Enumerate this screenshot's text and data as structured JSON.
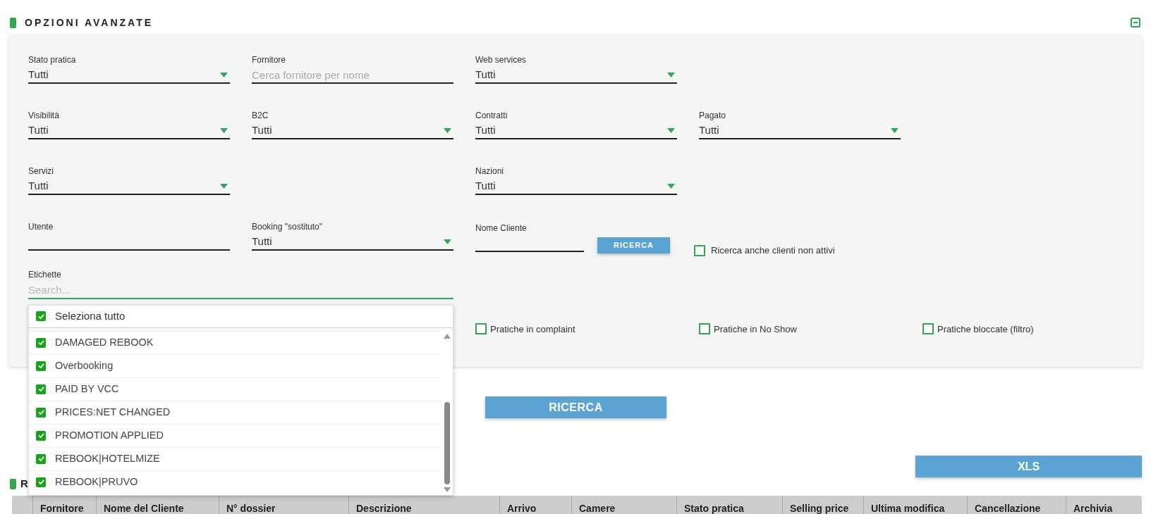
{
  "section_title": "OPZIONI AVANZATE",
  "filter_rows": [
    [
      {
        "kind": "select",
        "label": "Stato pratica",
        "value": "Tutti"
      },
      {
        "kind": "text",
        "label": "Fornitore",
        "placeholder": "Cerca fornitore per nome"
      },
      {
        "kind": "select",
        "label": "Web services",
        "value": "Tutti"
      }
    ],
    [
      {
        "kind": "select",
        "label": "Visibilità",
        "value": "Tutti"
      },
      {
        "kind": "select",
        "label": "B2C",
        "value": "Tutti"
      },
      {
        "kind": "select",
        "label": "Contratti",
        "value": "Tutti"
      },
      {
        "kind": "select",
        "label": "Pagato",
        "value": "Tutti"
      }
    ],
    [
      {
        "kind": "select",
        "label": "Servizi",
        "value": "Tutti"
      },
      {
        "kind": "empty"
      },
      {
        "kind": "select",
        "label": "Nazioni",
        "value": "Tutti"
      }
    ],
    [
      {
        "kind": "text",
        "label": "Utente"
      },
      {
        "kind": "select",
        "label": "Booking \"sostituto\"",
        "value": "Tutti"
      },
      {
        "kind": "client_search",
        "label": "Nome Cliente",
        "button": "RICERCA"
      },
      {
        "kind": "checkbox",
        "label": "Ricerca anche clienti non attivi",
        "checked": false
      }
    ]
  ],
  "tags": {
    "label": "Etichette",
    "placeholder": "Search...",
    "dropdown": {
      "select_all": {
        "label": "Seleziona tutto",
        "checked": true
      },
      "options": [
        {
          "label": "DAMAGED REBOOK",
          "checked": true
        },
        {
          "label": "Overbooking",
          "checked": true
        },
        {
          "label": "PAID BY VCC",
          "checked": true
        },
        {
          "label": "PRICES:NET CHANGED",
          "checked": true
        },
        {
          "label": "PROMOTION APPLIED",
          "checked": true
        },
        {
          "label": "REBOOK|HOTELMIZE",
          "checked": true
        },
        {
          "label": "REBOOK|PRUVO",
          "checked": true
        }
      ]
    }
  },
  "flags": [
    {
      "label": "Pratiche in complaint",
      "checked": false
    },
    {
      "label": "Pratiche in No Show",
      "checked": false
    },
    {
      "label": "Pratiche bloccate (filtro)",
      "checked": false
    }
  ],
  "search_button": "RICERCA",
  "export_button": "XLS",
  "results": {
    "title": "R",
    "columns": [
      "Fornitore",
      "Nome del Cliente",
      "N° dossier",
      "Descrizione",
      "Arrivo",
      "Camere",
      "Stato pratica",
      "Selling price",
      "Ultima modifica",
      "Cancellazione",
      "Archivia"
    ]
  }
}
